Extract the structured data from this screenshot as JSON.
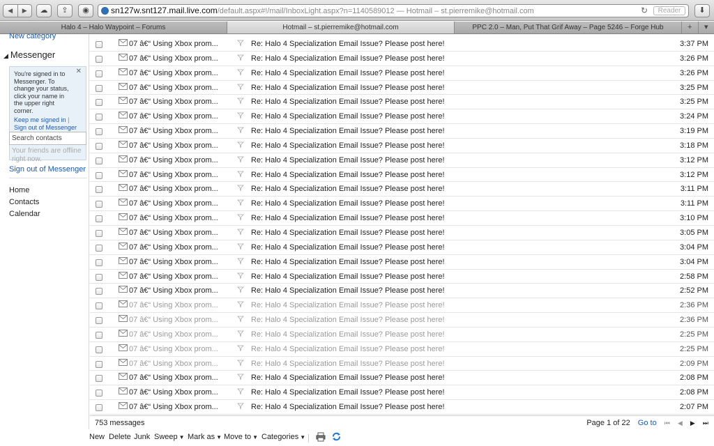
{
  "browser": {
    "url_site": "sn127w.snt127.mail.live.com",
    "url_path": "/default.aspx#!/mail/InboxLight.aspx?n=1140589012",
    "page_title": "Hotmail – st.pierremike@hotmail.com",
    "reader_label": "Reader",
    "tabs": [
      {
        "label": "Halo 4 – Halo Waypoint – Forums"
      },
      {
        "label": "Hotmail – st.pierremike@hotmail.com"
      },
      {
        "label": "PPC 2.0 – Man, Put That Grif Away – Page 5246 – Forge Hub"
      }
    ],
    "tab_add": "+",
    "tab_menu": "▾"
  },
  "sidebar": {
    "new_category": "New category",
    "messenger_title": "Messenger",
    "messenger_info": "You're signed in to Messenger. To change your status, click your name in the upper right corner.",
    "keep_signed_in": "Keep me signed in",
    "link_sep": "|",
    "sign_out_msgr": "Sign out of Messenger",
    "search_contacts": "Search contacts",
    "offline_text": "Your friends are offline right now.",
    "sign_out": "Sign out of Messenger",
    "nav": [
      "Home",
      "Contacts",
      "Calendar"
    ]
  },
  "messages": [
    {
      "from": "07 â€“ Using Xbox prom...",
      "subject": "Re: Halo 4 Specialization Email Issue? Please post here!",
      "time": "3:37 PM",
      "faded": false
    },
    {
      "from": "07 â€“ Using Xbox prom...",
      "subject": "Re: Halo 4 Specialization Email Issue? Please post here!",
      "time": "3:26 PM",
      "faded": false
    },
    {
      "from": "07 â€“ Using Xbox prom...",
      "subject": "Re: Halo 4 Specialization Email Issue? Please post here!",
      "time": "3:26 PM",
      "faded": false
    },
    {
      "from": "07 â€“ Using Xbox prom...",
      "subject": "Re: Halo 4 Specialization Email Issue? Please post here!",
      "time": "3:25 PM",
      "faded": false
    },
    {
      "from": "07 â€“ Using Xbox prom...",
      "subject": "Re: Halo 4 Specialization Email Issue? Please post here!",
      "time": "3:25 PM",
      "faded": false
    },
    {
      "from": "07 â€“ Using Xbox prom...",
      "subject": "Re: Halo 4 Specialization Email Issue? Please post here!",
      "time": "3:24 PM",
      "faded": false
    },
    {
      "from": "07 â€“ Using Xbox prom...",
      "subject": "Re: Halo 4 Specialization Email Issue? Please post here!",
      "time": "3:19 PM",
      "faded": false
    },
    {
      "from": "07 â€“ Using Xbox prom...",
      "subject": "Re: Halo 4 Specialization Email Issue? Please post here!",
      "time": "3:18 PM",
      "faded": false
    },
    {
      "from": "07 â€“ Using Xbox prom...",
      "subject": "Re: Halo 4 Specialization Email Issue? Please post here!",
      "time": "3:12 PM",
      "faded": false
    },
    {
      "from": "07 â€“ Using Xbox prom...",
      "subject": "Re: Halo 4 Specialization Email Issue? Please post here!",
      "time": "3:12 PM",
      "faded": false
    },
    {
      "from": "07 â€“ Using Xbox prom...",
      "subject": "Re: Halo 4 Specialization Email Issue? Please post here!",
      "time": "3:11 PM",
      "faded": false
    },
    {
      "from": "07 â€“ Using Xbox prom...",
      "subject": "Re: Halo 4 Specialization Email Issue? Please post here!",
      "time": "3:11 PM",
      "faded": false
    },
    {
      "from": "07 â€“ Using Xbox prom...",
      "subject": "Re: Halo 4 Specialization Email Issue? Please post here!",
      "time": "3:10 PM",
      "faded": false
    },
    {
      "from": "07 â€“ Using Xbox prom...",
      "subject": "Re: Halo 4 Specialization Email Issue? Please post here!",
      "time": "3:05 PM",
      "faded": false
    },
    {
      "from": "07 â€“ Using Xbox prom...",
      "subject": "Re: Halo 4 Specialization Email Issue? Please post here!",
      "time": "3:04 PM",
      "faded": false
    },
    {
      "from": "07 â€“ Using Xbox prom...",
      "subject": "Re: Halo 4 Specialization Email Issue? Please post here!",
      "time": "3:04 PM",
      "faded": false
    },
    {
      "from": "07 â€“ Using Xbox prom...",
      "subject": "Re: Halo 4 Specialization Email Issue? Please post here!",
      "time": "2:58 PM",
      "faded": false
    },
    {
      "from": "07 â€“ Using Xbox prom...",
      "subject": "Re: Halo 4 Specialization Email Issue? Please post here!",
      "time": "2:52 PM",
      "faded": false
    },
    {
      "from": "07 â€“ Using Xbox prom...",
      "subject": "Re: Halo 4 Specialization Email Issue? Please post here!",
      "time": "2:36 PM",
      "faded": true
    },
    {
      "from": "07 â€“ Using Xbox prom...",
      "subject": "Re: Halo 4 Specialization Email Issue? Please post here!",
      "time": "2:36 PM",
      "faded": true
    },
    {
      "from": "07 â€“ Using Xbox prom...",
      "subject": "Re: Halo 4 Specialization Email Issue? Please post here!",
      "time": "2:25 PM",
      "faded": true
    },
    {
      "from": "07 â€“ Using Xbox prom...",
      "subject": "Re: Halo 4 Specialization Email Issue? Please post here!",
      "time": "2:25 PM",
      "faded": true
    },
    {
      "from": "07 â€“ Using Xbox prom...",
      "subject": "Re: Halo 4 Specialization Email Issue? Please post here!",
      "time": "2:09 PM",
      "faded": true
    },
    {
      "from": "07 â€“ Using Xbox prom...",
      "subject": "Re: Halo 4 Specialization Email Issue? Please post here!",
      "time": "2:08 PM",
      "faded": false
    },
    {
      "from": "07 â€“ Using Xbox prom...",
      "subject": "Re: Halo 4 Specialization Email Issue? Please post here!",
      "time": "2:08 PM",
      "faded": false
    },
    {
      "from": "07 â€“ Using Xbox prom...",
      "subject": "Re: Halo 4 Specialization Email Issue? Please post here!",
      "time": "2:07 PM",
      "faded": false
    }
  ],
  "footer": {
    "count": "753 messages",
    "page_info": "Page 1 of 22",
    "goto": "Go to",
    "first": "⏮",
    "prev": "◀",
    "next": "▶",
    "last": "⏭"
  },
  "actions": {
    "new": "New",
    "delete": "Delete",
    "junk": "Junk",
    "sweep": "Sweep",
    "mark_as": "Mark as",
    "move_to": "Move to",
    "categories": "Categories",
    "arrow": "▼"
  },
  "icon_names": [
    "back-icon",
    "forward-icon",
    "icloud-icon",
    "share-icon",
    "sidebar-icon",
    "reload-icon",
    "download-icon",
    "envelope-icon",
    "flag-icon",
    "print-icon",
    "refresh-icon"
  ],
  "colors": {
    "link": "#1a5ab8",
    "messenger_box": "#e9f1f8"
  }
}
